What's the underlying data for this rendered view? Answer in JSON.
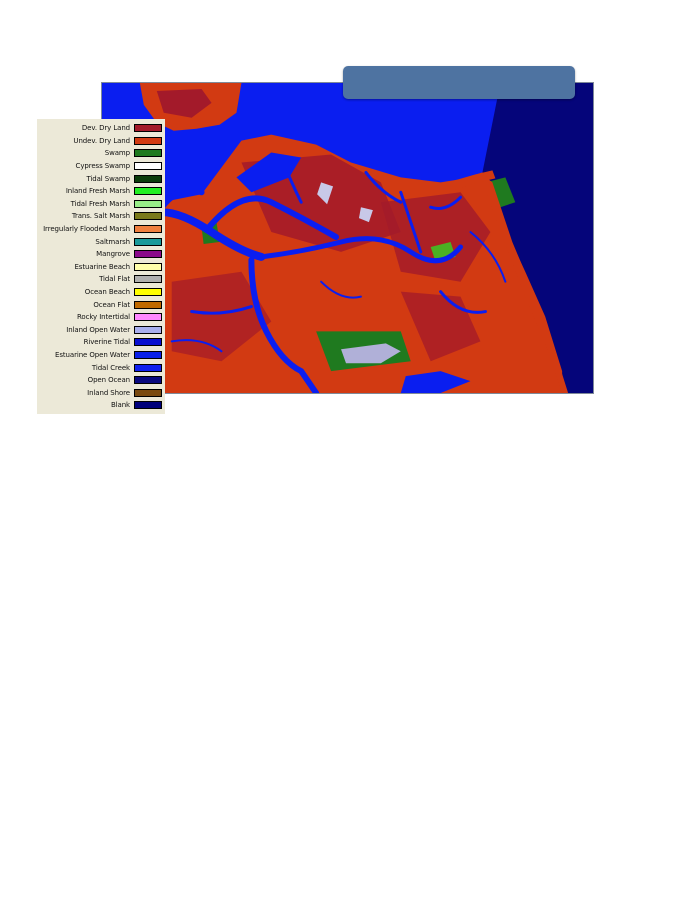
{
  "legend": {
    "items": [
      {
        "label": "Dev. Dry Land",
        "color": "#a31a2a"
      },
      {
        "label": "Undev. Dry Land",
        "color": "#d23a12"
      },
      {
        "label": "Swamp",
        "color": "#1f7a1f"
      },
      {
        "label": "Cypress Swamp",
        "color": "#ffffff"
      },
      {
        "label": "Tidal Swamp",
        "color": "#0b3d0b"
      },
      {
        "label": "Inland Fresh Marsh",
        "color": "#22ee22"
      },
      {
        "label": "Tidal Fresh Marsh",
        "color": "#99ee88"
      },
      {
        "label": "Trans. Salt Marsh",
        "color": "#7a7a1a"
      },
      {
        "label": "Irregularly Flooded Marsh",
        "color": "#f08040"
      },
      {
        "label": "Saltmarsh",
        "color": "#1a9a9a"
      },
      {
        "label": "Mangrove",
        "color": "#8a0a8a"
      },
      {
        "label": "Estuarine Beach",
        "color": "#ffffaa"
      },
      {
        "label": "Tidal Flat",
        "color": "#b0b0b0"
      },
      {
        "label": "Ocean Beach",
        "color": "#ffff00"
      },
      {
        "label": "Ocean Flat",
        "color": "#c06a00"
      },
      {
        "label": "Rocky Intertidal",
        "color": "#ff88ff"
      },
      {
        "label": "Inland Open Water",
        "color": "#aab0ee"
      },
      {
        "label": "Riverine Tidal",
        "color": "#0a10d0"
      },
      {
        "label": "Estuarine Open Water",
        "color": "#0a20e8"
      },
      {
        "label": "Tidal Creek",
        "color": "#1020ee"
      },
      {
        "label": "Open Ocean",
        "color": "#0a0a80"
      },
      {
        "label": "Inland Shore",
        "color": "#7a4a10"
      },
      {
        "label": "Blank",
        "color": "#00007a"
      }
    ]
  },
  "colors": {
    "estuarine_water": "#0a1ef0",
    "open_ocean": "#05057a",
    "developed_land": "#a31a2a",
    "undeveloped_land": "#d23a12",
    "title_banner": "#4e73a1"
  }
}
